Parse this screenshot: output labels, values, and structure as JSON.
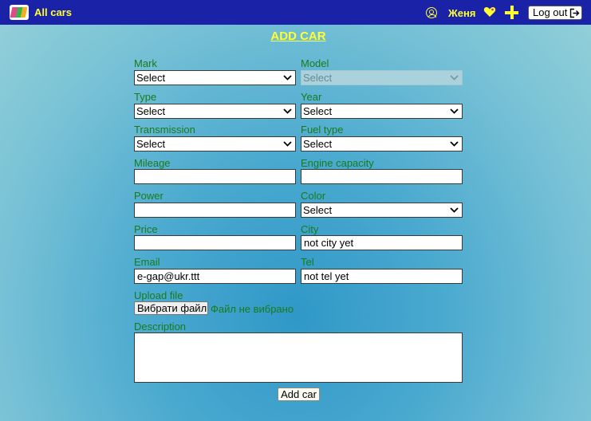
{
  "colors": {
    "topbar": "#1a22a8",
    "accent_yellow": "#ffff33",
    "label_green": "#197b1a",
    "background": "#4aa9cf"
  },
  "header": {
    "logo_icon": "app-logo-icon",
    "brand": "All cars",
    "user_icon": "user-circle-icon",
    "username": "Женя",
    "favorites_icon": "heart-icon",
    "add_icon": "plus-icon",
    "logout_label": "Log out",
    "logout_icon": "logout-arrow-icon"
  },
  "form": {
    "title": "ADD CAR",
    "mark": {
      "label": "Mark",
      "value": "Select"
    },
    "model": {
      "label": "Model",
      "value": "Select",
      "disabled": true
    },
    "type": {
      "label": "Type",
      "value": "Select"
    },
    "year": {
      "label": "Year",
      "value": "Select"
    },
    "transmission": {
      "label": "Transmission",
      "value": "Select"
    },
    "fuel": {
      "label": "Fuel type",
      "value": "Select"
    },
    "mileage": {
      "label": "Mileage",
      "value": ""
    },
    "engine": {
      "label": "Engine capacity",
      "value": ""
    },
    "power": {
      "label": "Power",
      "value": ""
    },
    "color": {
      "label": "Color",
      "value": "Select"
    },
    "price": {
      "label": "Price",
      "value": ""
    },
    "city": {
      "label": "City",
      "value": "not city yet"
    },
    "email": {
      "label": "Email",
      "value": "e-gap@ukr.ttt"
    },
    "tel": {
      "label": "Tel",
      "value": "not tel yet"
    },
    "upload": {
      "label": "Upload file",
      "button": "Вибрати файл",
      "status": "Файл не вибрано"
    },
    "description": {
      "label": "Description",
      "value": ""
    },
    "submit": "Add car"
  }
}
